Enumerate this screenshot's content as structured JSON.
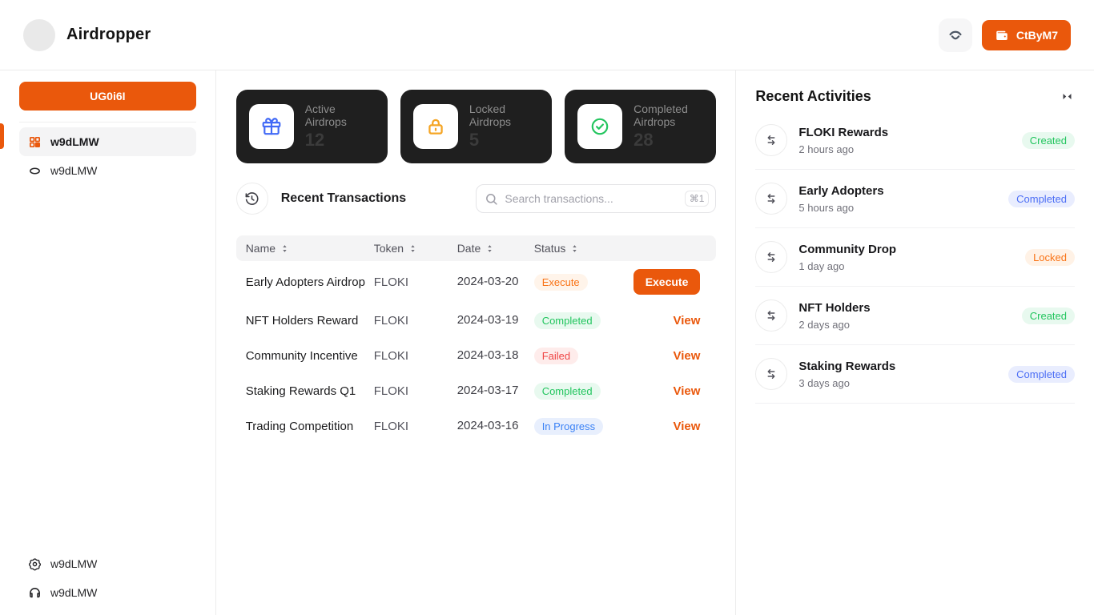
{
  "header": {
    "app_title": "Airdropper",
    "logo_icon": "app-logo-circle",
    "secondary_button_icon": "walletconnect-icon",
    "wallet_button": {
      "icon": "wallet-icon",
      "label": "CtByM7"
    }
  },
  "sidebar": {
    "create_button_label": "UG0i6I",
    "items": [
      {
        "icon": "dashboard-grid-icon",
        "label": "w9dLMW",
        "active": true
      },
      {
        "icon": "coin-icon",
        "label": "w9dLMW",
        "active": false
      }
    ],
    "footer_items": [
      {
        "icon": "gear-icon",
        "label": "w9dLMW"
      },
      {
        "icon": "headphones-icon",
        "label": "w9dLMW"
      }
    ]
  },
  "stats": {
    "cards": [
      {
        "icon": "gift-icon",
        "icon_color": "#4169f6",
        "label": "Active Airdrops",
        "value": "12"
      },
      {
        "icon": "lock-icon",
        "icon_color": "#f5a524",
        "label": "Locked Airdrops",
        "value": "5"
      },
      {
        "icon": "check-circle-icon",
        "icon_color": "#22c55e",
        "label": "Completed Airdrops",
        "value": "28"
      }
    ]
  },
  "transactions": {
    "section_icon": "history-icon",
    "title": "Recent Transactions",
    "search": {
      "icon": "search-icon",
      "placeholder": "Search transactions...",
      "shortcut": "⌘1"
    },
    "columns": [
      "Name",
      "Token",
      "Date",
      "Status"
    ],
    "rows": [
      {
        "name": "Early Adopters Airdrop",
        "token": "FLOKI",
        "date": "2024-03-20",
        "status": "Execute",
        "status_type": "execute",
        "action": "Execute",
        "action_type": "button"
      },
      {
        "name": "NFT Holders Reward",
        "token": "FLOKI",
        "date": "2024-03-19",
        "status": "Completed",
        "status_type": "completed",
        "action": "View",
        "action_type": "link"
      },
      {
        "name": "Community Incentive",
        "token": "FLOKI",
        "date": "2024-03-18",
        "status": "Failed",
        "status_type": "failed",
        "action": "View",
        "action_type": "link"
      },
      {
        "name": "Staking Rewards Q1",
        "token": "FLOKI",
        "date": "2024-03-17",
        "status": "Completed",
        "status_type": "completed",
        "action": "View",
        "action_type": "link"
      },
      {
        "name": "Trading Competition",
        "token": "FLOKI",
        "date": "2024-03-16",
        "status": "In Progress",
        "status_type": "in-progress",
        "action": "View",
        "action_type": "link"
      }
    ]
  },
  "activities": {
    "title": "Recent Activities",
    "collapse_icon": "collapse-panel-icon",
    "item_icon": "transfer-arrows-icon",
    "items": [
      {
        "title": "FLOKI Rewards",
        "time": "2 hours ago",
        "badge": "Created",
        "badge_type": "created"
      },
      {
        "title": "Early Adopters",
        "time": "5 hours ago",
        "badge": "Completed",
        "badge_type": "completed"
      },
      {
        "title": "Community Drop",
        "time": "1 day ago",
        "badge": "Locked",
        "badge_type": "locked"
      },
      {
        "title": "NFT Holders",
        "time": "2 days ago",
        "badge": "Created",
        "badge_type": "created"
      },
      {
        "title": "Staking Rewards",
        "time": "3 days ago",
        "badge": "Completed",
        "badge_type": "completed"
      }
    ]
  },
  "colors": {
    "primary": "#ea580c",
    "stat_card_bg": "#1f1f1f",
    "badge_green": "#22c55e",
    "badge_red": "#ef4444",
    "badge_blue": "#3b82f6",
    "badge_indigo": "#4c6ef5",
    "badge_orange": "#f97316"
  }
}
